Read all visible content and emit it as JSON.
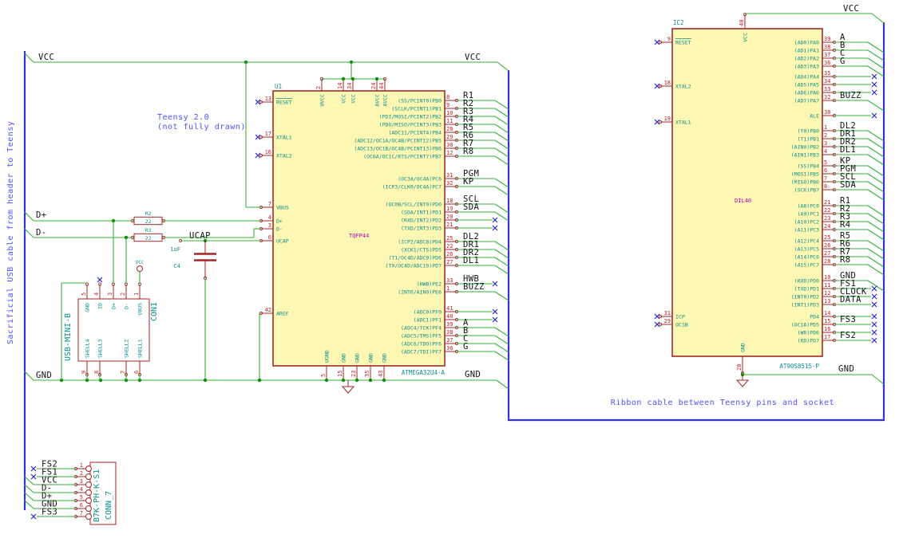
{
  "notes": {
    "teensy_line1": "Teensy 2.0",
    "teensy_line2": "(not fully drawn)",
    "ribbon": "Ribbon cable between Teensy pins and socket",
    "side": "Sacrificial USB cable from header to Teensy"
  },
  "power": {
    "vcc_left": "VCC",
    "vcc_right": "VCC",
    "gnd_left": "GND",
    "gnd_right": "GND",
    "vcc_ic2_top": "VCC",
    "gnd_ic2": "GND",
    "dplus": "D+",
    "dminus": "D-",
    "ucap": "UCAP",
    "vcc_symbol": "VCC"
  },
  "u1": {
    "ref": "U1",
    "value": "ATMEGA32U4-A",
    "package": "TQFP44",
    "left_pins": [
      {
        "name": "RESET",
        "num": "13",
        "nc": true,
        "overline": true
      },
      {
        "name": "XTAL1",
        "num": "17",
        "nc": true
      },
      {
        "name": "XTAL2",
        "num": "16",
        "nc": true
      },
      {
        "name": "VBUS",
        "num": "7"
      },
      {
        "name": "D+",
        "num": "4"
      },
      {
        "name": "D-",
        "num": "3"
      },
      {
        "name": "UCAP",
        "num": "6"
      },
      {
        "name": "AREF",
        "num": "42"
      }
    ],
    "top_pins": [
      {
        "name": "UVCC",
        "num": "2"
      },
      {
        "name": "VCC",
        "num": "14"
      },
      {
        "name": "VCC",
        "num": "34"
      },
      {
        "name": "AVCC",
        "num": "24"
      },
      {
        "name": "AVCC",
        "num": "44"
      }
    ],
    "bottom_pins": [
      {
        "name": "UGND",
        "num": "5"
      },
      {
        "name": "GND",
        "num": "15"
      },
      {
        "name": "GND",
        "num": "23"
      },
      {
        "name": "GND",
        "num": "35"
      },
      {
        "name": "GND",
        "num": "43"
      }
    ],
    "right_pins": [
      {
        "name": "(SS/PCINT0)PB0",
        "num": "8",
        "net": "R1",
        "term": "bus"
      },
      {
        "name": "(SCLK/PCINT1)PB1",
        "num": "9",
        "net": "R2",
        "term": "bus"
      },
      {
        "name": "(PDI/MOSI/PCINT2)PB2",
        "num": "10",
        "net": "R3",
        "term": "bus"
      },
      {
        "name": "(PDO/MISO/PCINT3)PB3",
        "num": "11",
        "net": "R4",
        "term": "bus"
      },
      {
        "name": "(ADC11/PCINT4)PB4",
        "num": "28",
        "net": "R5",
        "term": "bus"
      },
      {
        "name": "(ADC12/OC1A/OC4B/PCINT12)PB5",
        "num": "29",
        "net": "R6",
        "term": "bus"
      },
      {
        "name": "(ADC13/OC1B/OC4B/PCINT13)PB6",
        "num": "30",
        "net": "R7",
        "term": "bus"
      },
      {
        "name": "(OC0A/OC1C/RTS/PCINT7)PB7",
        "num": "12",
        "net": "R8",
        "term": "bus"
      },
      {
        "name": "(OC3A/OC4A)PC6",
        "num": "31",
        "net": "PGM",
        "term": "bus"
      },
      {
        "name": "(ICP3/CLK0/OC4A)PC7",
        "num": "32",
        "net": "KP",
        "term": "bus"
      },
      {
        "name": "(OC0B/SCL/INT0)PD0",
        "num": "18",
        "net": "SCL",
        "term": "bus"
      },
      {
        "name": "(SDA/INT1)PD1",
        "num": "19",
        "net": "SDA",
        "term": "bus"
      },
      {
        "name": "(RXD/INT2)PD2",
        "num": "20",
        "net": "",
        "term": "nc"
      },
      {
        "name": "(TXD/INT3)PD3",
        "num": "21",
        "net": "",
        "term": "nc"
      },
      {
        "name": "(ICP2/ADC8)PD4",
        "num": "25",
        "net": "DL2",
        "term": "bus"
      },
      {
        "name": "(XCK1/CTS)PD5",
        "num": "22",
        "net": "DR1",
        "term": "bus"
      },
      {
        "name": "(T1/OC4D/ADC9)PD6",
        "num": "26",
        "net": "DR2",
        "term": "bus"
      },
      {
        "name": "(T0/OC4D/ADC10)PD7",
        "num": "27",
        "net": "DL1",
        "term": "bus"
      },
      {
        "name": "(HWB)PE2",
        "num": "33",
        "net": "HWB",
        "term": "nc"
      },
      {
        "name": "(INT6/AIN0)PE6",
        "num": "1",
        "net": "BUZZ",
        "term": "bus"
      },
      {
        "name": "(ADC0)PF0",
        "num": "41",
        "net": "",
        "term": "nc"
      },
      {
        "name": "(ADC1)PF1",
        "num": "40",
        "net": "",
        "term": "nc"
      },
      {
        "name": "(ADC4/TCK)PF4",
        "num": "39",
        "net": "A",
        "term": "bus"
      },
      {
        "name": "(ADC5/TMS)PF5",
        "num": "38",
        "net": "B",
        "term": "bus"
      },
      {
        "name": "(ADC6/TDO)PF6",
        "num": "37",
        "net": "C",
        "term": "bus"
      },
      {
        "name": "(ADC7/TDI)PF7",
        "num": "36",
        "net": "G",
        "term": "bus"
      }
    ]
  },
  "ic2": {
    "ref": "IC2",
    "value": "AT90S8515-P",
    "package": "DIL40",
    "left_pins": [
      {
        "name": "RESET",
        "num": "9",
        "nc": true,
        "overline": true
      },
      {
        "name": "XTAL2",
        "num": "18",
        "nc": true
      },
      {
        "name": "XTAL1",
        "num": "19",
        "nc": true
      },
      {
        "name": "ICP",
        "num": "31",
        "nc": true
      },
      {
        "name": "OC1B",
        "num": "29",
        "nc": true
      }
    ],
    "top_pins": [
      {
        "name": "VCC",
        "num": "40"
      }
    ],
    "bottom_pins": [
      {
        "name": "GND",
        "num": "20"
      }
    ],
    "right_pins": [
      {
        "name": "(AD0)PA0",
        "num": "39",
        "net": "A",
        "term": "bus"
      },
      {
        "name": "(AD1)PA1",
        "num": "38",
        "net": "B",
        "term": "bus"
      },
      {
        "name": "(AD2)PA2",
        "num": "37",
        "net": "C",
        "term": "bus"
      },
      {
        "name": "(AD3)PA3",
        "num": "36",
        "net": "G",
        "term": "bus"
      },
      {
        "name": "(AD4)PA4",
        "num": "35",
        "net": "",
        "term": "nc"
      },
      {
        "name": "(AD5)PA5",
        "num": "34",
        "net": "",
        "term": "nc"
      },
      {
        "name": "(AD6)PA6",
        "num": "33",
        "net": "",
        "term": "nc"
      },
      {
        "name": "(AD7)PA7",
        "num": "32",
        "net": "BUZZ",
        "term": "bus"
      },
      {
        "name": "ALE",
        "num": "30",
        "net": "",
        "term": "nc"
      },
      {
        "name": "(T0)PB0",
        "num": "1",
        "net": "DL2",
        "term": "bus"
      },
      {
        "name": "(T1)PB1",
        "num": "2",
        "net": "DR1",
        "term": "bus"
      },
      {
        "name": "(AIN0)PB2",
        "num": "3",
        "net": "DR2",
        "term": "bus"
      },
      {
        "name": "(AIN1)PB3",
        "num": "4",
        "net": "DL1",
        "term": "bus"
      },
      {
        "name": "(SS)PB4",
        "num": "5",
        "net": "KP",
        "term": "bus"
      },
      {
        "name": "(MOSI)PB5",
        "num": "6",
        "net": "PGM",
        "term": "bus"
      },
      {
        "name": "(MISO)PB6",
        "num": "7",
        "net": "SCL",
        "term": "bus"
      },
      {
        "name": "(SCK)PB7",
        "num": "8",
        "net": "SDA",
        "term": "bus"
      },
      {
        "name": "(A8)PC0",
        "num": "21",
        "net": "R1",
        "term": "bus"
      },
      {
        "name": "(A9)PC1",
        "num": "22",
        "net": "R2",
        "term": "bus"
      },
      {
        "name": "(A10)PC2",
        "num": "23",
        "net": "R3",
        "term": "bus"
      },
      {
        "name": "(A11)PC3",
        "num": "24",
        "net": "R4",
        "term": "bus"
      },
      {
        "name": "(A12)PC4",
        "num": "25",
        "net": "R5",
        "term": "bus"
      },
      {
        "name": "(A13)PC5",
        "num": "26",
        "net": "R6",
        "term": "bus"
      },
      {
        "name": "(A14)PC6",
        "num": "27",
        "net": "R7",
        "term": "bus"
      },
      {
        "name": "(A15)PC7",
        "num": "28",
        "net": "R8",
        "term": "bus"
      },
      {
        "name": "(RXD)PD0",
        "num": "10",
        "net": "GND",
        "term": "bus"
      },
      {
        "name": "(TXD)PD1",
        "num": "11",
        "net": "FS1",
        "term": "nc"
      },
      {
        "name": "(INT0)PD2",
        "num": "12",
        "net": "CLOCK",
        "term": "nc"
      },
      {
        "name": "(INT1)PD3",
        "num": "13",
        "net": "DATA",
        "term": "nc"
      },
      {
        "name": "PD4",
        "num": "14",
        "net": "",
        "term": "nc"
      },
      {
        "name": "(OC1A)PD5",
        "num": "15",
        "net": "FS3",
        "term": "nc"
      },
      {
        "name": "(WR)PD6",
        "num": "16",
        "net": "",
        "term": "nc"
      },
      {
        "name": "(RD)PD7",
        "num": "17",
        "net": "FS2",
        "term": "nc"
      }
    ]
  },
  "con1": {
    "ref": "CON1",
    "value": "USB-MINI-B",
    "top_pins": [
      {
        "name": "GND",
        "num": "5"
      },
      {
        "name": "ID",
        "num": "4",
        "nc": true
      },
      {
        "name": "D+",
        "num": "3"
      },
      {
        "name": "D-",
        "num": "2"
      },
      {
        "name": "VBUS",
        "num": "1"
      }
    ],
    "bottom_pins": [
      {
        "name": "SHELL4",
        "num": "9"
      },
      {
        "name": "SHELL3",
        "num": "8"
      },
      {
        "name": "SHELL2",
        "num": "7"
      },
      {
        "name": "SHELL1",
        "num": "6"
      }
    ]
  },
  "conn7": {
    "ref": "CONN_7",
    "value": "B7K-PH-K-S1",
    "pins": [
      {
        "num": "1",
        "net": "FS2",
        "term": "nc"
      },
      {
        "num": "2",
        "net": "FS1",
        "term": "nc"
      },
      {
        "num": "3",
        "net": "VCC",
        "term": "bus"
      },
      {
        "num": "4",
        "net": "D-",
        "term": "bus"
      },
      {
        "num": "5",
        "net": "D+",
        "term": "bus"
      },
      {
        "num": "6",
        "net": "GND",
        "term": "bus"
      },
      {
        "num": "7",
        "net": "FS3",
        "term": "nc"
      }
    ]
  },
  "r2": {
    "ref": "R2",
    "value": "22"
  },
  "r3": {
    "ref": "R3",
    "value": "22"
  },
  "c4": {
    "ref": "C4",
    "value": "1uF"
  },
  "colors": {
    "wire": "#35b035",
    "junction": "#0d8c0d",
    "bus": "#3434d6",
    "body_fill": "#fcf7b3",
    "body_edge": "#9c1f1f",
    "pin": "#a22626",
    "pin_name": "#0d8e8e",
    "pin_num": "#c22020",
    "net_label": "#101010",
    "nc": "#2626cc",
    "note": "#5050ff",
    "package": "#bf00bf"
  }
}
